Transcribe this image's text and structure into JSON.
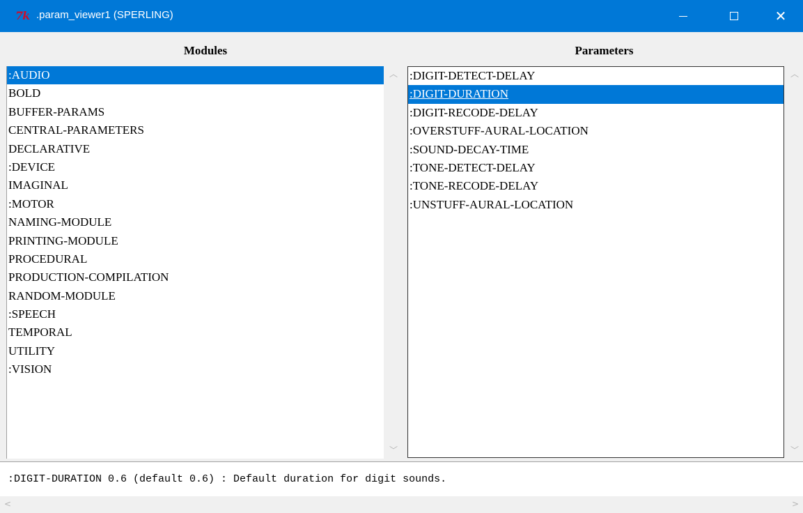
{
  "window": {
    "app_icon_text": "7k",
    "title": ".param_viewer1 (SPERLING)",
    "minimize_label": "Minimize",
    "maximize_label": "Maximize",
    "close_glyph": "✕"
  },
  "modules": {
    "title": "Modules",
    "items": [
      ":AUDIO",
      "BOLD",
      "BUFFER-PARAMS",
      "CENTRAL-PARAMETERS",
      "DECLARATIVE",
      ":DEVICE",
      "IMAGINAL",
      ":MOTOR",
      "NAMING-MODULE",
      "PRINTING-MODULE",
      "PROCEDURAL",
      "PRODUCTION-COMPILATION",
      "RANDOM-MODULE",
      ":SPEECH",
      "TEMPORAL",
      "UTILITY",
      ":VISION"
    ],
    "selected": ":AUDIO"
  },
  "parameters": {
    "title": "Parameters",
    "items": [
      ":DIGIT-DETECT-DELAY",
      ":DIGIT-DURATION",
      ":DIGIT-RECODE-DELAY",
      ":OVERSTUFF-AURAL-LOCATION",
      ":SOUND-DECAY-TIME",
      ":TONE-DETECT-DELAY",
      ":TONE-RECODE-DELAY",
      ":UNSTUFF-AURAL-LOCATION"
    ],
    "selected": ":DIGIT-DURATION"
  },
  "detail": {
    "text": ":DIGIT-DURATION 0.6 (default 0.6) : Default duration for digit sounds."
  },
  "icons": {
    "scroll_up": "chevron-up-icon",
    "scroll_down": "chevron-down-icon",
    "scroll_left": "chevron-left-icon",
    "scroll_right": "chevron-right-icon"
  },
  "colors": {
    "titlebar": "#0078d7",
    "selection": "#0078d7",
    "app_icon": "#c8102e"
  }
}
